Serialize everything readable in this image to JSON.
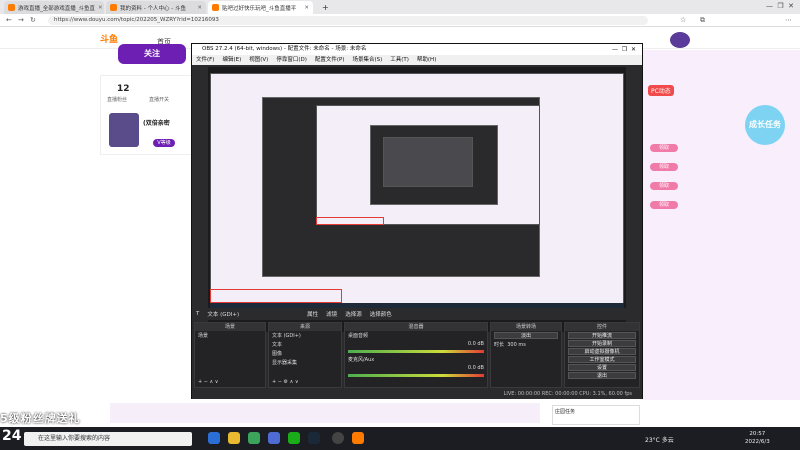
{
  "browser": {
    "tabs": [
      {
        "label": "游戏直播_全部游戏直播_斗鱼直",
        "color": "#ff7b00"
      },
      {
        "label": "我的资料 - 个人中心 - 斗鱼",
        "color": "#ff7b00"
      },
      {
        "label": "贴吧过好快乐玩吧_斗鱼直播平",
        "color": "#ff7b00"
      }
    ],
    "url": "https://www.douyu.com/topic/202205_WZRY?rid=10216093",
    "new_tab": "+"
  },
  "site": {
    "logo": "斗鱼",
    "nav": [
      "首页",
      "分类"
    ],
    "stats": [
      {
        "value": "12",
        "label": "直播粉丝"
      },
      {
        "value": "",
        "label": "直播开关"
      }
    ],
    "streamer_name": "(双倍亲密",
    "level_btn": "V等级",
    "follow_btn": "关注",
    "right_panel": {
      "title": "PC动态",
      "buttons": [
        "成长任务",
        "领取",
        "领取",
        "领取",
        "领取"
      ],
      "event_label": "庄园任务"
    },
    "danmu_caption": "5级粉丝牌送礼"
  },
  "obs": {
    "title": "OBS 27.2.4 (64-bit, windows) - 配置文件: 未命名 - 场景: 未命名",
    "menu": [
      "文件(F)",
      "编辑(E)",
      "视图(V)",
      "停靠窗口(D)",
      "配置文件(P)",
      "场景集合(S)",
      "工具(T)",
      "帮助(H)"
    ],
    "scene_toolbar": [
      "文本 (GDI+)",
      "属性",
      "滤镜",
      "选择源",
      "选择颜色"
    ],
    "docks": {
      "scenes": {
        "header": "场景",
        "items": [
          "场景"
        ]
      },
      "sources": {
        "header": "来源",
        "items": [
          "文本 (GDI+)",
          "文本",
          "图像",
          "显示器采集"
        ]
      },
      "mixer": {
        "header": "混音器",
        "channels": [
          {
            "name": "桌面音频",
            "db": "0.0 dB"
          },
          {
            "name": "麦克风/Aux",
            "db": "0.0 dB"
          }
        ]
      },
      "transitions": {
        "header": "场景转场",
        "type": "淡出",
        "duration_label": "时长",
        "duration": "300 ms"
      },
      "controls": {
        "header": "控件",
        "buttons": [
          "开始推流",
          "开始录制",
          "启动虚拟摄像机",
          "工作室模式",
          "设置",
          "退出"
        ]
      }
    },
    "status": "LIVE: 00:00:00   REC: 00:00:00   CPU: 3.1%, 60.00 fps"
  },
  "taskbar": {
    "search_placeholder": "在这里输入你要搜索的内容",
    "weather": "23°C 多云",
    "time": "20:57",
    "date": "2022/6/3",
    "big_label": "24"
  }
}
